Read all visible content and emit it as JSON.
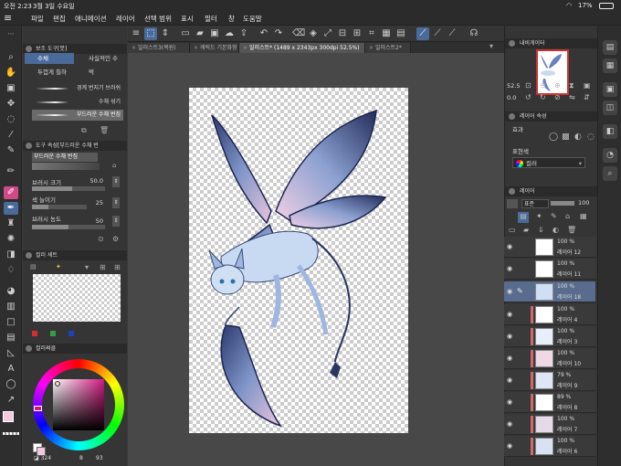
{
  "status": {
    "time": "오전 2:23",
    "date": "3월 3일 수요일",
    "battery": "17%"
  },
  "menu": [
    "파일",
    "편집",
    "애니메이션",
    "레이어",
    "선택 범위",
    "표시",
    "필터",
    "창",
    "도움말"
  ],
  "tabs": [
    {
      "label": "일러스트3(복원)",
      "active": false
    },
    {
      "label": "캐릭드 기본화형",
      "active": false
    },
    {
      "label": "일러스트* (1489 x 2343px 300dpi 52.5%)",
      "active": true
    },
    {
      "label": "일러스트2*",
      "active": false
    }
  ],
  "left_panel": {
    "subtool_header": "보조 도구[붓]",
    "subtools": [
      "수채",
      "사실적인 수",
      "두껍게 칠하",
      "먹"
    ],
    "brushes": [
      {
        "label": "경계 번지기 브러쉬",
        "selected": false
      },
      {
        "label": "수채 섞기",
        "selected": false
      },
      {
        "label": "부드러운 수채 번짐",
        "selected": true
      }
    ],
    "tool_property_header": "도구 속성[부드러운 수채 번",
    "tool_name": "부드러운 수채 번짐",
    "properties": [
      {
        "label": "브러시 크기",
        "value": "50.0",
        "level": 0.55
      },
      {
        "label": "색 늘이기",
        "value": "25",
        "level": 0.3
      },
      {
        "label": "브러시 농도",
        "value": "50",
        "level": 0.5
      }
    ],
    "color_set_header": "컬러 세트",
    "color_wheel_header": "컬러써클",
    "color_readout": {
      "a": "324",
      "b": "8",
      "c": "93"
    }
  },
  "navigator": {
    "header": "내비게이터",
    "zoom": "52.5",
    "rotation": "0.0"
  },
  "layer_property": {
    "header": "레이어 속성",
    "effect_label": "효과",
    "expression_label": "표현색",
    "expression_value": "컬러"
  },
  "layers_panel": {
    "header": "레이어",
    "blend_mode": "표준",
    "opacity": "100",
    "layers": [
      {
        "pct": "100 %",
        "name": "레이어 12",
        "selected": false,
        "clip": false
      },
      {
        "pct": "100 %",
        "name": "레이어 11",
        "selected": false,
        "clip": false
      },
      {
        "pct": "100 %",
        "name": "레이어 18",
        "selected": true,
        "clip": false
      },
      {
        "pct": "100 %",
        "name": "레이어 4",
        "selected": false,
        "clip": true
      },
      {
        "pct": "100 %",
        "name": "레이어 3",
        "selected": false,
        "clip": true
      },
      {
        "pct": "100 %",
        "name": "레이어 10",
        "selected": false,
        "clip": true
      },
      {
        "pct": "79 %",
        "name": "레이어 9",
        "selected": false,
        "clip": true
      },
      {
        "pct": "89 %",
        "name": "레이어 8",
        "selected": false,
        "clip": true
      },
      {
        "pct": "100 %",
        "name": "레이어 7",
        "selected": false,
        "clip": true
      },
      {
        "pct": "100 %",
        "name": "레이어 6",
        "selected": false,
        "clip": true
      }
    ]
  },
  "colors": {
    "accent": "#4a6a9a",
    "main_color": "#f3c9dd",
    "sub_color": "#ffffff"
  }
}
